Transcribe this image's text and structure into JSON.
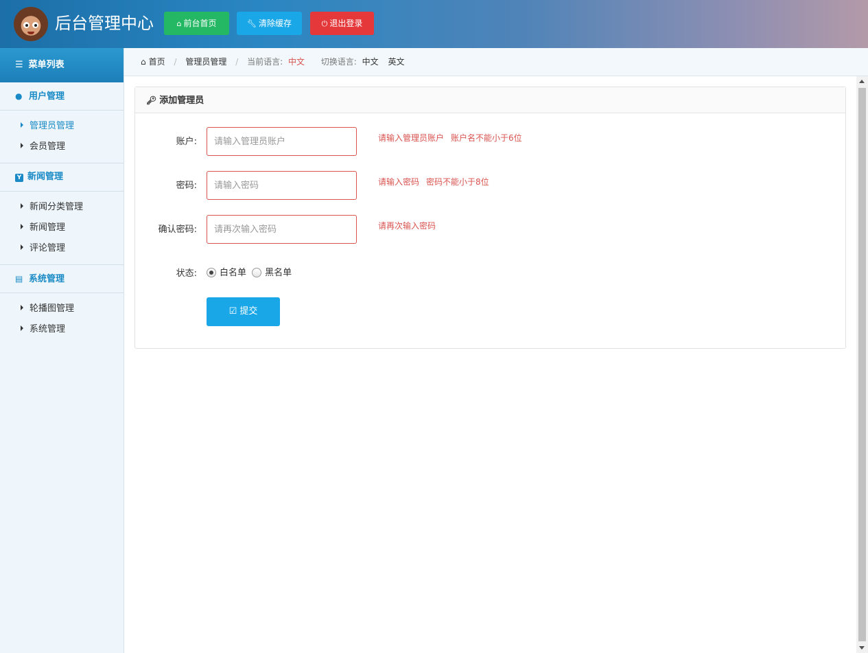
{
  "header": {
    "brand": "后台管理中心",
    "buttons": {
      "home": "前台首页",
      "cache": "清除缓存",
      "logout": "退出登录"
    }
  },
  "sidebar": {
    "title": "菜单列表",
    "groups": [
      {
        "label": "用户管理",
        "icon": "user-icon",
        "items": [
          {
            "label": "管理员管理",
            "active": true
          },
          {
            "label": "会员管理"
          }
        ]
      },
      {
        "label": "新闻管理",
        "icon": "news-icon",
        "items": [
          {
            "label": "新闻分类管理"
          },
          {
            "label": "新闻管理"
          },
          {
            "label": "评论管理"
          }
        ]
      },
      {
        "label": "系统管理",
        "icon": "system-icon",
        "items": [
          {
            "label": "轮播图管理"
          },
          {
            "label": "系统管理"
          }
        ]
      }
    ]
  },
  "breadcrumb": {
    "home": "首页",
    "current": "管理员管理",
    "lang_label": "当前语言:",
    "lang_value": "中文",
    "switch_label": "切换语言:",
    "switch_zh": "中文",
    "switch_en": "英文"
  },
  "form": {
    "title": "添加管理员",
    "account": {
      "label": "账户:",
      "placeholder": "请输入管理员账户",
      "errors": [
        "请输入管理员账户",
        "账户名不能小于6位"
      ]
    },
    "password": {
      "label": "密码:",
      "placeholder": "请输入密码",
      "errors": [
        "请输入密码",
        "密码不能小于8位"
      ]
    },
    "confirm": {
      "label": "确认密码:",
      "placeholder": "请再次输入密码",
      "errors": [
        "请再次输入密码"
      ]
    },
    "status": {
      "label": "状态:",
      "options": [
        "白名单",
        "黑名单"
      ],
      "selected": "白名单"
    },
    "submit": "提交"
  },
  "colors": {
    "accent": "#1aa7e8",
    "success": "#25b864",
    "danger": "#e5383b",
    "error_text": "#d9534f",
    "menu_link": "#1a8ac6"
  }
}
